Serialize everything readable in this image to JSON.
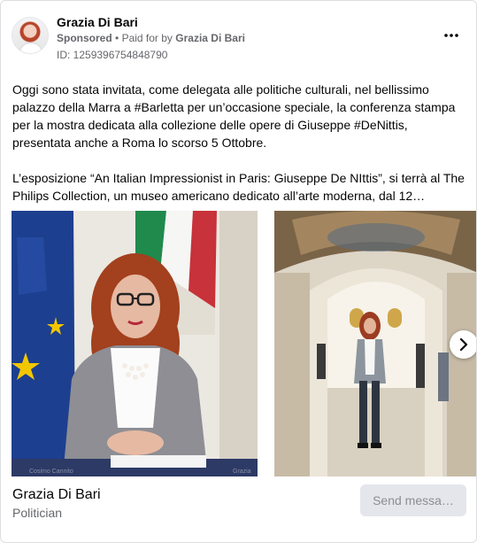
{
  "post": {
    "page_name": "Grazia Di Bari",
    "sponsored_label": "Sponsored",
    "separator": "•",
    "paid_for_prefix": "Paid for by",
    "paid_for_name": "Grazia Di Bari",
    "ad_id": "ID: 1259396754848790",
    "more_icon": "more-horizontal-icon",
    "body_paragraph_1": "Oggi sono stata invitata, come delegata alle politiche culturali, nel bellissimo palazzo della Marra a #Barletta per un’occasione speciale, la conferenza stampa per la mostra dedicata alla collezione delle opere di Giuseppe #DeNittis, presentata anche a Roma lo scorso 5 Ottobre.",
    "body_paragraph_2": "L’esposizione “An Italian Impressionist in Paris: Giuseppe De NIttis”, si terrà al The Philips Collection, un museo americano dedicato all’arte moderna, dal 12…"
  },
  "carousel": {
    "slide_1_caption_left": "Cosimo Cannito",
    "slide_1_caption_right": "Grazia",
    "next_icon": "chevron-right-icon"
  },
  "cta": {
    "name": "Grazia Di Bari",
    "subtitle": "Politician",
    "button_label": "Send messa…"
  },
  "colors": {
    "text_primary": "#050505",
    "text_secondary": "#65676b",
    "button_disabled_bg": "#e4e6eb",
    "button_disabled_text": "#8a8d91"
  }
}
